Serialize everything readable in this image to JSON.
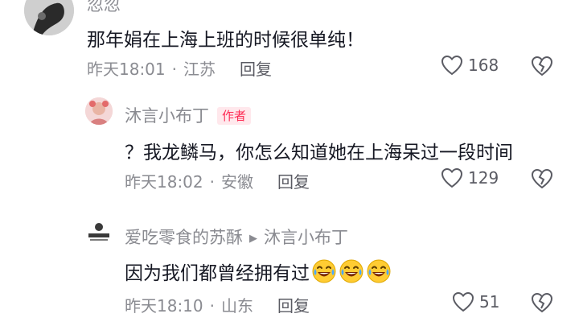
{
  "comments": [
    {
      "username": "忽忽",
      "text": "那年娟在上海上班的时候很单纯！",
      "time": "昨天18:01",
      "location": "江苏",
      "reply_label": "回复",
      "likes": "168"
    },
    {
      "username": "沐言小布丁",
      "badge": "作者",
      "text": "？我龙鳞马，你怎么知道她在上海呆过一段时间",
      "time": "昨天18:02",
      "location": "安徽",
      "reply_label": "回复",
      "likes": "129"
    },
    {
      "username": "爱吃零食的苏酥",
      "reply_to": "沐言小布丁",
      "text": "因为我们都曾经拥有过",
      "emoji": "laughing-crying-emoji",
      "emoji_count": 3,
      "time": "昨天18:10",
      "location": "山东",
      "reply_label": "回复",
      "likes": "51"
    }
  ],
  "colors": {
    "primary_text": "#161823",
    "secondary_text": "#8a8b91",
    "badge": "#fe2c55"
  }
}
